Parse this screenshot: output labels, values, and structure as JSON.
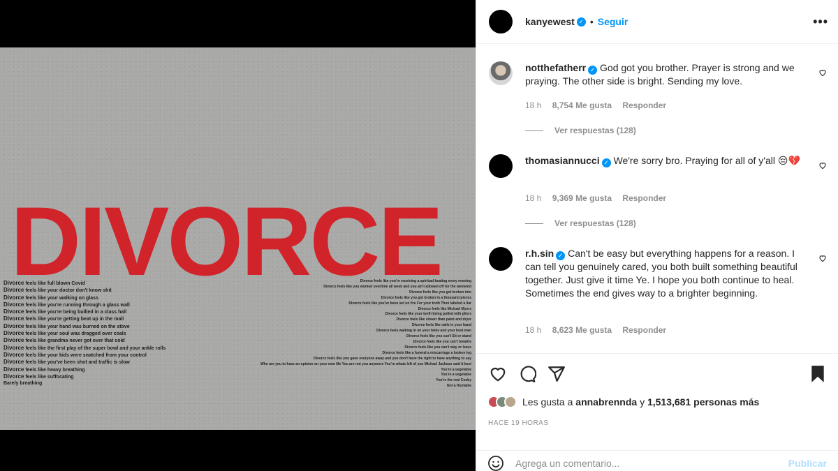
{
  "post": {
    "author": "kanyewest",
    "follow_label": "Seguir",
    "separator": "•",
    "more_label": "•••"
  },
  "media": {
    "title": "DIVORCE",
    "left_lines": [
      {
        "w": "Divorce",
        "t": "feels like full blown Covid"
      },
      {
        "w": "Divorce",
        "t": "feels like your doctor don't know shit"
      },
      {
        "w": "Divorce",
        "t": "feels like your walking on glass"
      },
      {
        "w": "Divorce",
        "t": "feels like you're running through a glass wall"
      },
      {
        "w": "Divorce",
        "t": "feels like you're being bullied in a class hall"
      },
      {
        "w": "Divorce",
        "t": "feels like you're getting beat up in the mall"
      },
      {
        "w": "Divorce",
        "t": "feels like your hand was burned on the stove"
      },
      {
        "w": "Divorce",
        "t": "feels like your soul was dragged over coals"
      },
      {
        "w": "Divorce",
        "t": "feels like grandma never got over that cold"
      },
      {
        "w": "Divorce",
        "t": "feels like the first play of the super bowl and your ankle rolls"
      },
      {
        "w": "Divorce",
        "t": "feels like your kids were snatched from your control"
      },
      {
        "w": "Divorce",
        "t": "feels like you've been shot and traffic is slow"
      },
      {
        "w": "Divorce",
        "t": "feels like heavy breathing"
      },
      {
        "w": "Divorce",
        "t": "feels like suffocating"
      },
      {
        "w": "",
        "t": "Barely breathing"
      }
    ],
    "right_lines": [
      "Divorce feels like you're receiving a spiritual beating every evening",
      "Divorce feels like you worked overtime all week and you ain't allowed off for the weekend",
      "Divorce feels like you got broken into",
      "Divorce feels like you got broken in a thousand pieces",
      "Divorce feels like you've been set on fire  For your truth  Then labeled a liar",
      "Divorce feels like Michael Myers",
      "Divorce feels like your teeth being pulled with pliers",
      "Divorce feels like slower than paint and dryer",
      "Divorce feels like nails in your hand",
      "Divorce feels walking in on your bride and your best man",
      "Divorce feels like you can't  Sit or stand",
      "Divorce feels like you can't breathe",
      "Divorce feels like you can't stay or leave",
      "Divorce feels like a funeral a miscarriage a broken leg",
      "Divorce feels like you gave everyone away and you don't have the right to have anything to say",
      "Who are you to have an opinion on your own life   You are not you anymore   You're whats left of you   Michael Jackson said it best",
      "You're a vegetable",
      "You're a vegetable",
      "You're the real Cosby",
      "Not a Huxtable"
    ]
  },
  "comments": [
    {
      "user": "notthefatherr",
      "text": "God got you brother. Prayer is strong and we praying. The other side is bright. Sending my love.",
      "time": "18 h",
      "likes": "8,754 Me gusta",
      "reply": "Responder",
      "view_replies": "Ver respuestas (128)"
    },
    {
      "user": "thomasiannucci",
      "text": "We're sorry bro. Praying for all of y'all 😔💔",
      "time": "18 h",
      "likes": "9,369 Me gusta",
      "reply": "Responder",
      "view_replies": "Ver respuestas (128)"
    },
    {
      "user": "r.h.sin",
      "text": "Can't be easy but everything happens for a reason. I can tell you genuinely cared, you both built something beautiful together. Just give it time Ye. I hope you both continue to heal. Sometimes the end gives way to a brighter beginning.",
      "time": "18 h",
      "likes": "8,623 Me gusta",
      "reply": "Responder"
    }
  ],
  "likes_line": {
    "prefix": "Les gusta a",
    "user": "annabrennda",
    "conj": "y",
    "count": "1,513,681 personas más"
  },
  "time_ago": "HACE 19 HORAS",
  "composer": {
    "placeholder": "Agrega un comentario...",
    "publish_label": "Publicar"
  },
  "colors": {
    "accent": "#0095f6",
    "poster_red": "#d1242a",
    "muted": "#8e8e8e"
  }
}
